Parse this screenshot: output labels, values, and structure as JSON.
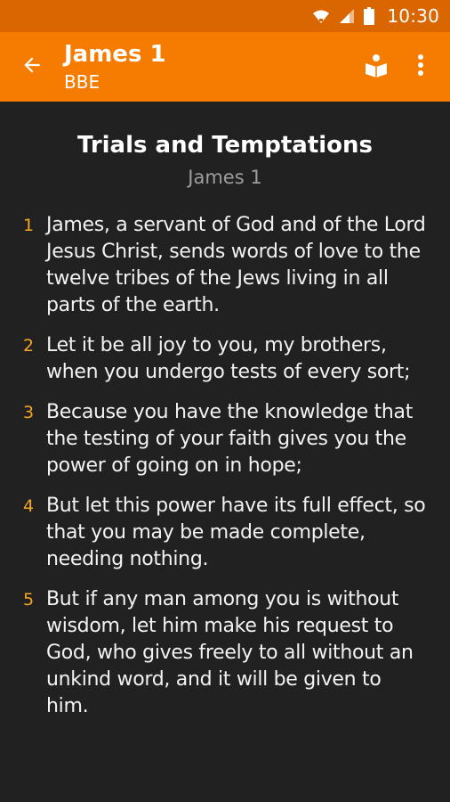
{
  "status_bar": {
    "time": "10:30",
    "icons": [
      "wifi-icon",
      "signal-icon",
      "battery-icon"
    ]
  },
  "app_bar": {
    "title": "James 1",
    "subtitle": "BBE",
    "back_icon": "arrow-back-icon",
    "actions": [
      "book-reader-icon",
      "more-vert-icon"
    ],
    "color": "#f57c00"
  },
  "passage": {
    "heading": "Trials and Temptations",
    "reference": "James 1",
    "verses": [
      {
        "num": "1",
        "text": "James, a servant of God and of the Lord Jesus Christ, sends words of love to the twelve tribes of the Jews living in all parts of the earth."
      },
      {
        "num": "2",
        "text": "Let it be all joy to you, my brothers, when you undergo tests of every sort;"
      },
      {
        "num": "3",
        "text": "Because you have the knowledge that the testing of your faith gives you the power of going on in hope;"
      },
      {
        "num": "4",
        "text": "But let this power have its full effect, so that you may be made complete, needing nothing."
      },
      {
        "num": "5",
        "text": "But if any man among you is without wisdom, let him make his request to God, who gives freely to all without an unkind word, and it will be given to him."
      }
    ]
  },
  "colors": {
    "background": "#212121",
    "verse_number": "#f5a623",
    "status_bar": "#d96600"
  }
}
